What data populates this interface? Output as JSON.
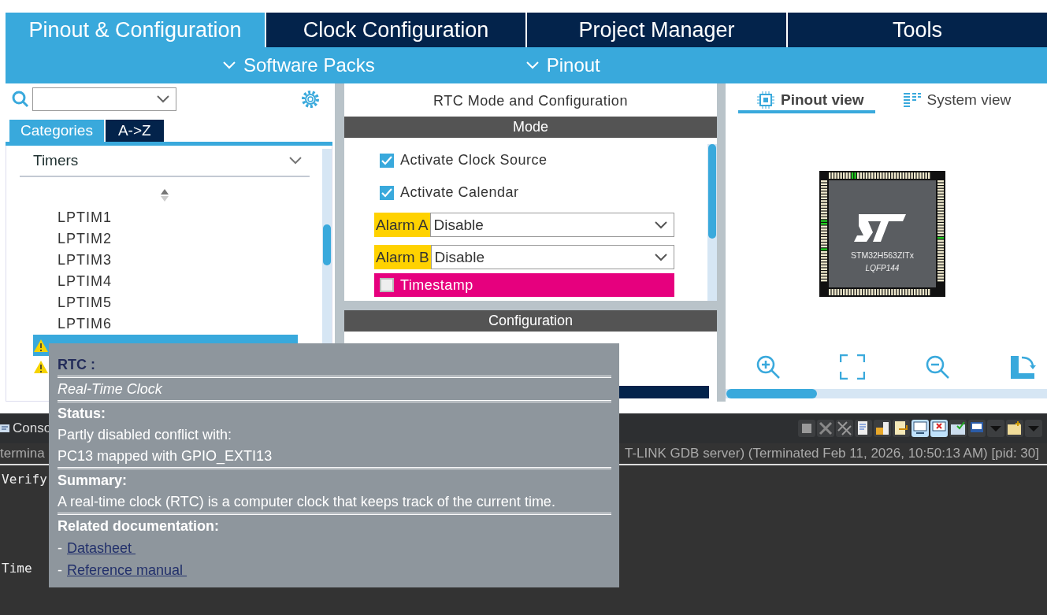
{
  "main_tabs": [
    {
      "label": "Pinout & Configuration",
      "selected": true
    },
    {
      "label": "Clock Configuration",
      "selected": false
    },
    {
      "label": "Project Manager",
      "selected": false
    },
    {
      "label": "Tools",
      "selected": false
    }
  ],
  "sub_menu": [
    "Software Packs",
    "Pinout"
  ],
  "left_panel": {
    "view_tabs": [
      {
        "label": "Categories",
        "selected": true
      },
      {
        "label": "A->Z",
        "selected": false
      }
    ],
    "category": "Timers",
    "items": [
      {
        "label": "LPTIM1",
        "selected": false,
        "warning": false
      },
      {
        "label": "LPTIM2",
        "selected": false,
        "warning": false
      },
      {
        "label": "LPTIM3",
        "selected": false,
        "warning": false
      },
      {
        "label": "LPTIM4",
        "selected": false,
        "warning": false
      },
      {
        "label": "LPTIM5",
        "selected": false,
        "warning": false
      },
      {
        "label": "LPTIM6",
        "selected": false,
        "warning": false
      },
      {
        "selected": true,
        "warning": true
      },
      {
        "selected": false,
        "warning": true
      }
    ]
  },
  "mode_panel": {
    "title": "RTC Mode and Configuration",
    "mode_header": "Mode",
    "rows": [
      {
        "kind": "checkbox",
        "label": "Activate Clock Source",
        "checked": true
      },
      {
        "kind": "checkbox",
        "label": "Activate Calendar",
        "checked": true
      },
      {
        "kind": "select",
        "label": "Alarm A",
        "value": "Disable",
        "color": "#ffd200"
      },
      {
        "kind": "select",
        "label": "Alarm B",
        "value": "Disable",
        "color": "#ffd200"
      },
      {
        "kind": "checkbox",
        "label": "Timestamp",
        "checked": false,
        "color": "#e6007e"
      }
    ],
    "config_header": "Configuration"
  },
  "pinout_panel": {
    "view_tabs": [
      {
        "label": "Pinout view",
        "selected": true
      },
      {
        "label": "System view",
        "selected": false
      }
    ],
    "chip_name": "STM32H563ZITx",
    "package": "LQFP144"
  },
  "console": {
    "tab": "Conso",
    "process_left": "termina",
    "process_right": "T-LINK GDB server) (Terminated Feb 11, 2026, 10:50:13 AM) [pid: 30]",
    "toolbar": [
      {
        "kind": "stop",
        "selected": false
      },
      {
        "kind": "remove",
        "selected": false
      },
      {
        "kind": "remove-all",
        "selected": false
      },
      {
        "kind": "clear",
        "selected": false
      },
      {
        "kind": "lock",
        "selected": false
      },
      {
        "kind": "wrap",
        "selected": false
      },
      {
        "kind": "show-out",
        "selected": true
      },
      {
        "kind": "show-err",
        "selected": true
      },
      {
        "kind": "pin",
        "selected": false
      },
      {
        "kind": "display",
        "selected": false
      },
      {
        "kind": "dropdown",
        "selected": false
      },
      {
        "kind": "new",
        "selected": false
      },
      {
        "kind": "dropdown",
        "selected": false
      }
    ],
    "lines": [
      "Verify",
      "Time"
    ]
  },
  "tooltip": {
    "title": "RTC :",
    "subtitle": "Real-Time Clock",
    "status_heading": "Status:",
    "status_lines": [
      "Partly disabled conflict with:",
      "PC13 mapped with GPIO_EXTI13"
    ],
    "summary_heading": "Summary:",
    "summary": "A real-time clock (RTC) is a computer clock that keeps track of the current time.",
    "docs_heading": "Related documentation:",
    "docs": [
      {
        "dash": "-",
        "link": "Datasheet "
      },
      {
        "dash": "-",
        "link": "Reference manual "
      }
    ]
  }
}
